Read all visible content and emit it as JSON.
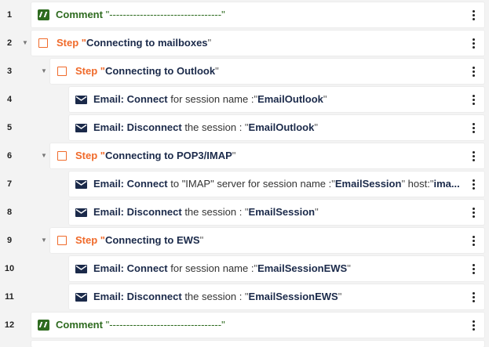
{
  "rows": [
    {
      "n": "1",
      "kw": "Comment",
      "q1": "\"",
      "v1": "---------------------------------",
      "q2": "\""
    },
    {
      "n": "2",
      "kw": "Step",
      "q1": "\"",
      "v1": "Connecting to mailboxes",
      "q2": "\""
    },
    {
      "n": "3",
      "kw": "Step",
      "q1": "\"",
      "v1": "Connecting to Outlook",
      "q2": "\""
    },
    {
      "n": "4",
      "kw": "Email: Connect",
      "t1": " for session name :",
      "q1": "\"",
      "v1": "EmailOutlook",
      "q2": "\""
    },
    {
      "n": "5",
      "kw": "Email: Disconnect",
      "t1": " the session : ",
      "q1": "\"",
      "v1": "EmailOutlook",
      "q2": "\""
    },
    {
      "n": "6",
      "kw": "Step",
      "q1": "\"",
      "v1": "Connecting to POP3/IMAP",
      "q2": "\""
    },
    {
      "n": "7",
      "kw": "Email: Connect",
      "t1": " to \"IMAP\" server for session name :",
      "q1": "\"",
      "v1": "EmailSession",
      "q2": "\"",
      "t2": " host:",
      "q3": "\"",
      "v2": "ima..."
    },
    {
      "n": "8",
      "kw": "Email: Disconnect",
      "t1": " the session : ",
      "q1": "\"",
      "v1": "EmailSession",
      "q2": "\""
    },
    {
      "n": "9",
      "kw": "Step",
      "q1": "\"",
      "v1": "Connecting to EWS",
      "q2": "\""
    },
    {
      "n": "10",
      "kw": "Email: Connect",
      "t1": " for session name :",
      "q1": "\"",
      "v1": "EmailSessionEWS",
      "q2": "\""
    },
    {
      "n": "11",
      "kw": "Email: Disconnect",
      "t1": " the session : ",
      "q1": "\"",
      "v1": "EmailSessionEWS",
      "q2": "\""
    },
    {
      "n": "12",
      "kw": "Comment",
      "q1": "\"",
      "v1": "---------------------------------",
      "q2": "\""
    }
  ],
  "icons": {
    "comment": "comment-icon",
    "step": "step-checkbox-icon",
    "email": "envelope-icon",
    "menu": "more-vertical-icon",
    "collapse": "chevron-down-icon"
  },
  "colors": {
    "step": "#f06a2a",
    "comment": "#2e6b1f",
    "email": "#1b2a4a",
    "background": "#f3f3f3"
  }
}
